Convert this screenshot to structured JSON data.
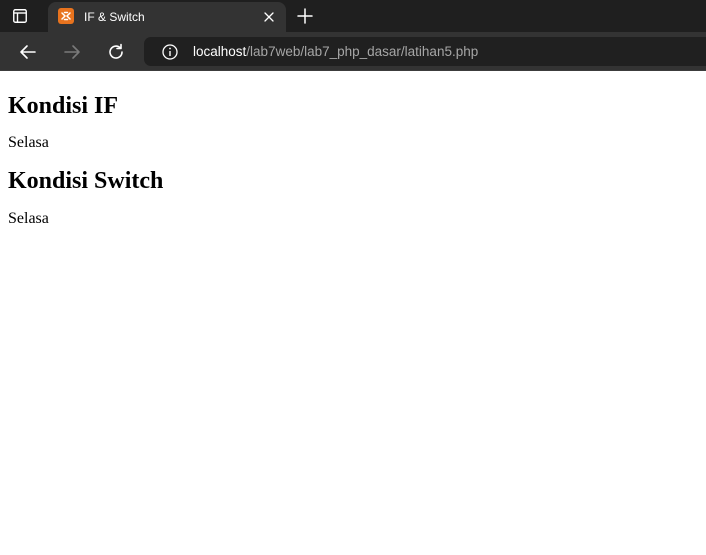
{
  "browser": {
    "tab": {
      "title": "IF & Switch"
    },
    "address": {
      "host": "localhost",
      "path": "/lab7web/lab7_php_dasar/latihan5.php"
    },
    "colors": {
      "tabbar": "#1f1f1f",
      "toolbar": "#333333",
      "omnibox": "#202020",
      "favicon": "#e8731e"
    }
  },
  "page": {
    "sections": [
      {
        "heading": "Kondisi IF",
        "result": "Selasa"
      },
      {
        "heading": "Kondisi Switch",
        "result": "Selasa"
      }
    ]
  }
}
